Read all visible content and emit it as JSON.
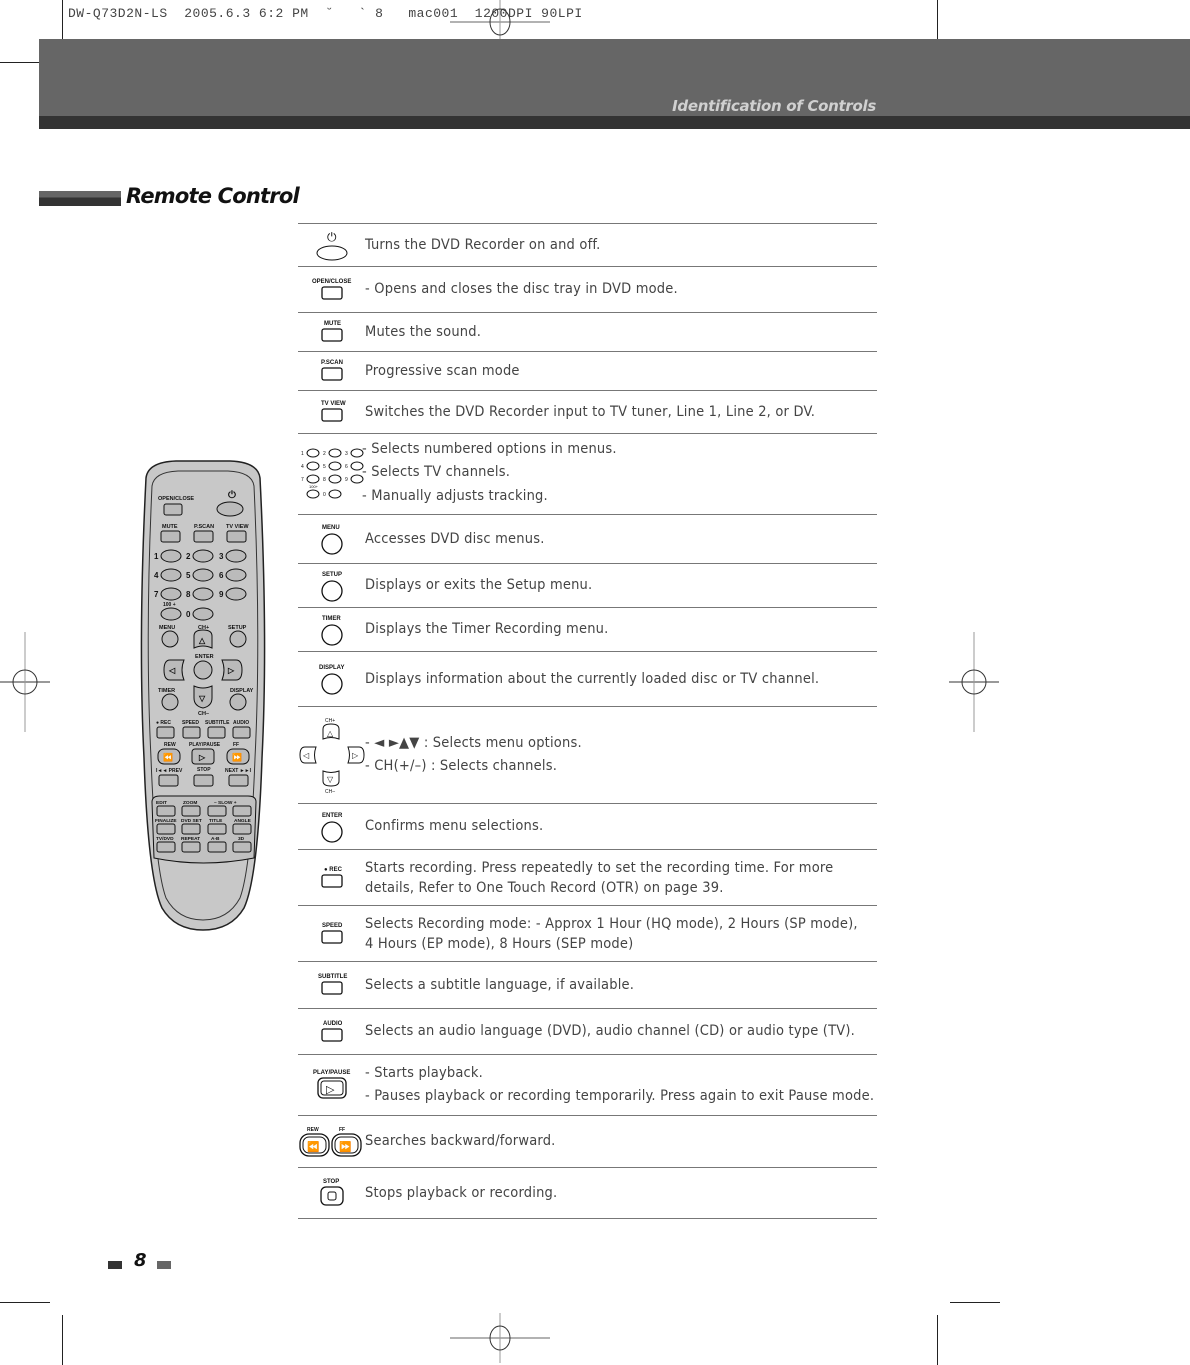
{
  "print_slug": "DW-Q73D2N-LS  2005.6.3 6:2 PM  ˘   ` 8   mac001  1200DPI 90LPI",
  "header": {
    "title": "Identification of Controls"
  },
  "section": {
    "title": "Remote Control"
  },
  "page_number": "8",
  "controls": [
    {
      "button": "POWER",
      "icon": "power-button-icon",
      "lines": [
        "Turns the DVD Recorder on and off."
      ]
    },
    {
      "button": "OPEN/CLOSE",
      "icon": "open-close-button-icon",
      "lines": [
        "- Opens and closes the disc tray in DVD mode."
      ]
    },
    {
      "button": "MUTE",
      "icon": "mute-button-icon",
      "lines": [
        "Mutes the sound."
      ]
    },
    {
      "button": "P.SCAN",
      "icon": "pscan-button-icon",
      "lines": [
        "Progressive scan mode"
      ]
    },
    {
      "button": "TV VIEW",
      "icon": "tv-view-button-icon",
      "lines": [
        "Switches the DVD Recorder input to TV tuner, Line 1, Line 2, or DV."
      ]
    },
    {
      "button": "0-9, 100+",
      "icon": "number-keypad-icon",
      "lines": [
        "- Selects numbered options in menus.",
        "- Selects TV channels.",
        "- Manually adjusts tracking."
      ]
    },
    {
      "button": "MENU",
      "icon": "menu-button-icon",
      "lines": [
        "Accesses DVD disc menus."
      ]
    },
    {
      "button": "SETUP",
      "icon": "setup-button-icon",
      "lines": [
        "Displays or exits the Setup menu."
      ]
    },
    {
      "button": "TIMER",
      "icon": "timer-button-icon",
      "lines": [
        "Displays the Timer Recording menu."
      ]
    },
    {
      "button": "DISPLAY",
      "icon": "display-button-icon",
      "lines": [
        "Displays information about the currently loaded disc or TV channel."
      ]
    },
    {
      "button": "CH+/CH-/◄►",
      "icon": "navigation-pad-icon",
      "lines": [
        "- ◄ ►▲▼ : Selects menu options.",
        "- CH(+/–) : Selects channels."
      ]
    },
    {
      "button": "ENTER",
      "icon": "enter-button-icon",
      "lines": [
        "Confirms menu selections."
      ]
    },
    {
      "button": "● REC",
      "icon": "record-button-icon",
      "lines": [
        "Starts recording. Press repeatedly to set the recording time. For more details, Refer to One Touch Record (OTR) on page 39."
      ]
    },
    {
      "button": "SPEED",
      "icon": "speed-button-icon",
      "lines": [
        "Selects Recording mode: - Approx 1 Hour (HQ mode), 2 Hours (SP mode), 4 Hours (EP mode), 8 Hours (SEP mode)"
      ]
    },
    {
      "button": "SUBTITLE",
      "icon": "subtitle-button-icon",
      "lines": [
        "Selects a subtitle language, if available."
      ]
    },
    {
      "button": "AUDIO",
      "icon": "audio-button-icon",
      "lines": [
        "Selects an audio language (DVD), audio channel (CD) or audio type (TV)."
      ]
    },
    {
      "button": "PLAY/PAUSE",
      "icon": "play-pause-button-icon",
      "lines": [
        "- Starts playback.",
        "- Pauses playback or recording temporarily. Press again to exit Pause mode."
      ]
    },
    {
      "button": "REW / FF",
      "icon": "rew-ff-buttons-icon",
      "lines": [
        "Searches backward/forward."
      ]
    },
    {
      "button": "STOP",
      "icon": "stop-button-icon",
      "lines": [
        "Stops playback or recording."
      ]
    }
  ],
  "remote_labels": {
    "open_close": "OPEN/CLOSE",
    "mute": "MUTE",
    "pscan": "P.SCAN",
    "tvview": "TV VIEW",
    "digits": [
      "1",
      "2",
      "3",
      "4",
      "5",
      "6",
      "7",
      "8",
      "9",
      "0"
    ],
    "hundred": "100 +",
    "menu": "MENU",
    "chplus": "CH+",
    "setup": "SETUP",
    "enter": "ENTER",
    "timer": "TIMER",
    "display": "DISPLAY",
    "chminus": "CH–",
    "rec": "● REC",
    "speed": "SPEED",
    "subtitle": "SUBTITLE",
    "audio": "AUDIO",
    "rew": "REW",
    "playpause": "PLAY/PAUSE",
    "ff": "FF",
    "prev": "I◄◄ PREV",
    "stop": "STOP",
    "next": "NEXT ►►I",
    "edit": "EDIT",
    "zoom": "ZOOM",
    "slow": "–  SLOW  +",
    "finalize": "FINALIZE",
    "dvdset": "DVD SET",
    "title": "TITLE",
    "angle": "ANGLE",
    "tvdvd": "TV/DVD",
    "repeat": "REPEAT",
    "ab": "A-B",
    "3d": "3D"
  }
}
